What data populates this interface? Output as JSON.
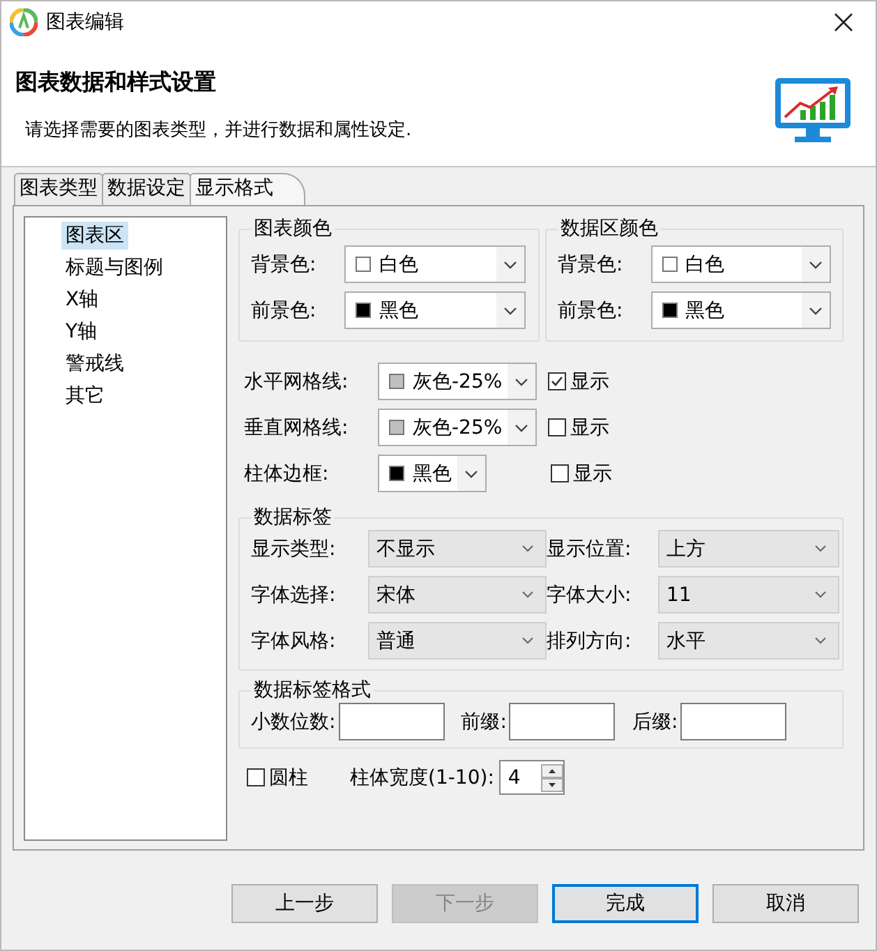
{
  "window": {
    "title": "图表编辑"
  },
  "header": {
    "title": "图表数据和样式设置",
    "description": "请选择需要的图表类型，并进行数据和属性设定."
  },
  "tabs": [
    {
      "label": "图表类型",
      "selected": false
    },
    {
      "label": "数据设定",
      "selected": false
    },
    {
      "label": "显示格式",
      "selected": true
    }
  ],
  "tree": [
    {
      "label": "图表区",
      "selected": true
    },
    {
      "label": "标题与图例",
      "selected": false
    },
    {
      "label": "X轴",
      "selected": false
    },
    {
      "label": "Y轴",
      "selected": false
    },
    {
      "label": "警戒线",
      "selected": false
    },
    {
      "label": "其它",
      "selected": false
    }
  ],
  "color_groups": [
    {
      "title": "图表颜色",
      "fields": [
        {
          "label": "背景色:",
          "value": "白色",
          "color": "#ffffff"
        },
        {
          "label": "前景色:",
          "value": "黑色",
          "color": "#000000"
        }
      ]
    },
    {
      "title": "数据区颜色",
      "fields": [
        {
          "label": "背景色:",
          "value": "白色",
          "color": "#ffffff"
        },
        {
          "label": "前景色:",
          "value": "黑色",
          "color": "#000000"
        }
      ]
    }
  ],
  "line_rows": [
    {
      "label": "水平网格线:",
      "value": "灰色-25%",
      "color": "#c0c0c0",
      "show": {
        "label": "显示",
        "checked": true
      }
    },
    {
      "label": "垂直网格线:",
      "value": "灰色-25%",
      "color": "#c0c0c0",
      "show": {
        "label": "显示",
        "checked": false
      }
    },
    {
      "label": "柱体边框:",
      "value": "黑色",
      "color": "#000000",
      "show": {
        "label": "显示",
        "checked": false
      }
    }
  ],
  "data_labels": {
    "title": "数据标签",
    "fields": [
      {
        "label": "显示类型:",
        "value": "不显示"
      },
      {
        "label": "显示位置:",
        "value": "上方"
      },
      {
        "label": "字体选择:",
        "value": "宋体"
      },
      {
        "label": "字体大小:",
        "value": "11"
      },
      {
        "label": "字体风格:",
        "value": "普通"
      },
      {
        "label": "排列方向:",
        "value": "水平"
      }
    ]
  },
  "label_format": {
    "title": "数据标签格式",
    "fields": [
      {
        "label": "小数位数:"
      },
      {
        "label": "前缀:"
      },
      {
        "label": "后缀:"
      }
    ]
  },
  "cylinder": {
    "label": "圆柱",
    "checked": false
  },
  "bar_width": {
    "label": "柱体宽度(1-10):",
    "value": "4"
  },
  "buttons": [
    {
      "label": "上一步",
      "disabled": false,
      "default": false
    },
    {
      "label": "下一步",
      "disabled": true,
      "default": false
    },
    {
      "label": "完成",
      "disabled": false,
      "default": true
    },
    {
      "label": "取消",
      "disabled": false,
      "default": false
    }
  ]
}
